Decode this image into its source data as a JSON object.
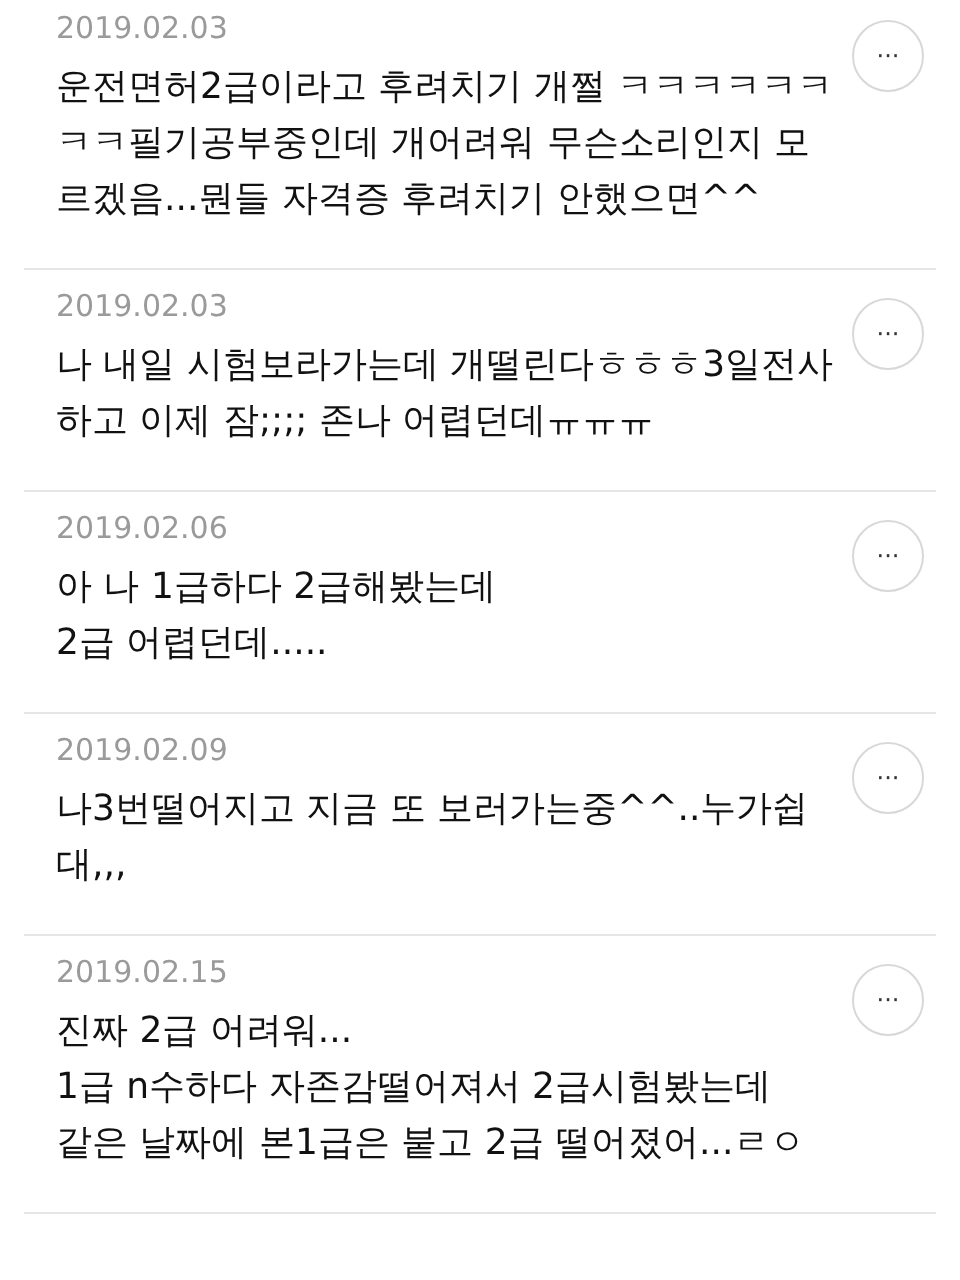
{
  "comments": [
    {
      "date": "2019.02.03",
      "text": "운전면허2급이라고 후려치기 개쩔 ㅋㅋㅋㅋㅋㅋㅋㅋ필기공부중인데 개어려워 무슨소리인지 모르겠음...뭔들 자격증 후려치기 안했으면^^",
      "more": "···"
    },
    {
      "date": "2019.02.03",
      "text": "나 내일 시험보라가는데 개떨린다ㅎㅎㅎ3일전사하고 이제 잠;;;; 존나 어렵던데ㅠㅠㅠ",
      "more": "···"
    },
    {
      "date": "2019.02.06",
      "text": "아 나 1급하다 2급해봤는데\n2급 어렵던데.....",
      "more": "···"
    },
    {
      "date": "2019.02.09",
      "text": "나3번떨어지고 지금 또 보러가는중^^..누가쉽대,,,",
      "more": "···"
    },
    {
      "date": "2019.02.15",
      "text": "진짜 2급 어려워...\n1급 n수하다 자존감떨어져서 2급시험봤는데\n같은 날짜에 본1급은 붙고 2급 떨어졌어...ㄹㅇ",
      "more": "···"
    }
  ]
}
